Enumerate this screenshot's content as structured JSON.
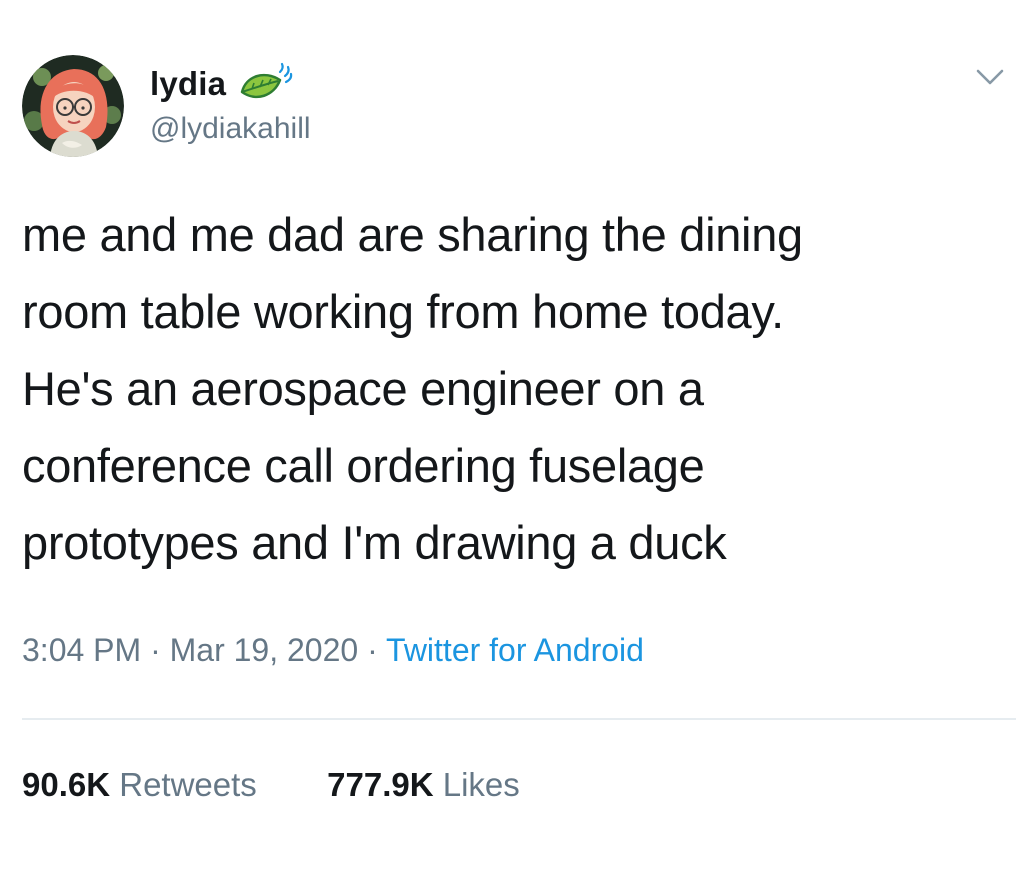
{
  "author": {
    "display_name": "lydia",
    "handle": "@lydiakahill",
    "badge_icon": "leaf-icon",
    "menu_icon": "chevron-down-icon"
  },
  "tweet": {
    "text_lines": [
      "me and me dad are sharing the dining",
      "room table working from home today.",
      "He's an aerospace engineer on a",
      "conference call ordering fuselage",
      "prototypes and I'm drawing a duck"
    ],
    "time": "3:04 PM",
    "separator": "·",
    "date": "Mar 19, 2020",
    "source": "Twitter for Android"
  },
  "stats": {
    "retweets_count": "90.6K",
    "retweets_label": "Retweets",
    "likes_count": "777.9K",
    "likes_label": "Likes"
  },
  "colors": {
    "text_primary": "#14171a",
    "text_secondary": "#657786",
    "link": "#1b95e0",
    "divider": "#e6ecf0",
    "leaf_green": "#8cc63f",
    "leaf_dark": "#2e7d32"
  }
}
